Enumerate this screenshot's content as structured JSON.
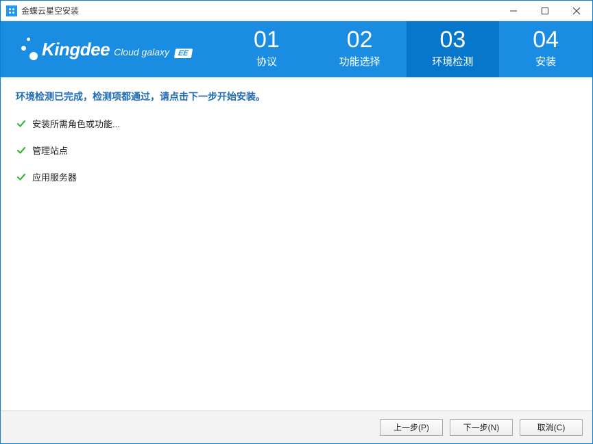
{
  "titlebar": {
    "title": "金蝶云星空安装"
  },
  "brand": {
    "name": "Kingdee",
    "subtitle": "Cloud galaxy",
    "badge": "EE"
  },
  "steps": [
    {
      "num": "01",
      "label": "协议"
    },
    {
      "num": "02",
      "label": "功能选择"
    },
    {
      "num": "03",
      "label": "环境检测"
    },
    {
      "num": "04",
      "label": "安装"
    }
  ],
  "main": {
    "status_message": "环境检测已完成，检测项都通过，请点击下一步开始安装。",
    "checks": [
      {
        "label": "安装所需角色或功能..."
      },
      {
        "label": "管理站点"
      },
      {
        "label": "应用服务器"
      }
    ]
  },
  "footer": {
    "prev": "上一步(P)",
    "next": "下一步(N)",
    "cancel": "取消(C)"
  }
}
